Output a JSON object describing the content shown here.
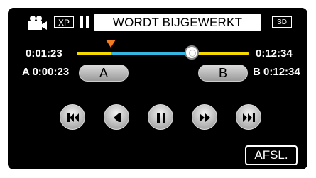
{
  "status": {
    "mode_icon": "movie-camera-icon",
    "quality_badge": "XP",
    "state_icon": "pause-icon",
    "message": "WORDT BIJGEWERKT",
    "media_badge": "SD"
  },
  "timeline": {
    "current_time": "0:01:23",
    "total_time": "0:12:34",
    "progress_fraction": 0.67,
    "playhead_marker_fraction": 0.2
  },
  "trim": {
    "a_label": "A",
    "a_time": "0:00:23",
    "a_button": "A",
    "b_label": "B",
    "b_time": "0:12:34",
    "b_button": "B"
  },
  "controls": [
    {
      "name": "skip-back-icon"
    },
    {
      "name": "frame-back-icon"
    },
    {
      "name": "pause-icon"
    },
    {
      "name": "fast-forward-icon"
    },
    {
      "name": "skip-forward-icon"
    }
  ],
  "end_button": "AFSL.",
  "colors": {
    "unselected_track": "#f5d800",
    "selected_track": "#35b6e0",
    "marker": "#f47a20"
  }
}
